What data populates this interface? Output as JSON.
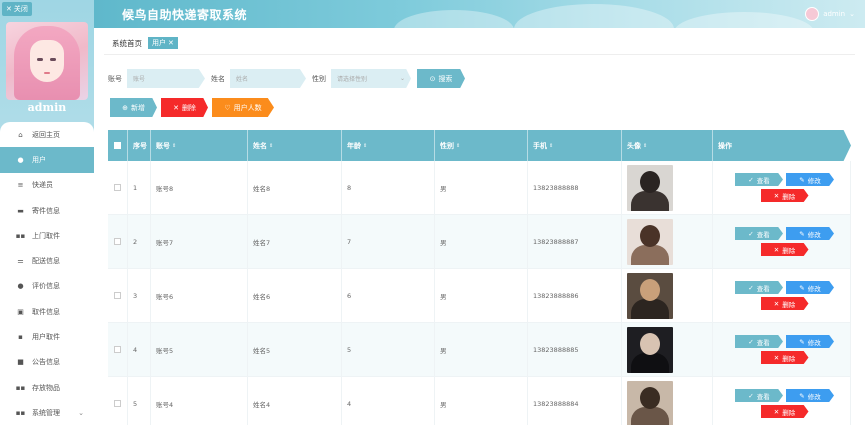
{
  "window": {
    "close_label": "关闭",
    "app_title": "候鸟自助快递寄取系统",
    "username": "admin"
  },
  "sidebar": {
    "profile_name": "admin",
    "items": [
      {
        "label": "返回主页",
        "icon": "home-icon"
      },
      {
        "label": "用户",
        "icon": "user-icon",
        "active": true
      },
      {
        "label": "快递员",
        "icon": "list-icon"
      },
      {
        "label": "寄件信息",
        "icon": "monitor-icon"
      },
      {
        "label": "上门取件",
        "icon": "grid-icon"
      },
      {
        "label": "配送信息",
        "icon": "sliders-icon"
      },
      {
        "label": "评价信息",
        "icon": "location-icon"
      },
      {
        "label": "取件信息",
        "icon": "clipboard-icon"
      },
      {
        "label": "用户取件",
        "icon": "bag-icon"
      },
      {
        "label": "公告信息",
        "icon": "video-icon"
      },
      {
        "label": "存放物品",
        "icon": "grid-icon"
      },
      {
        "label": "系统管理",
        "icon": "grid-icon",
        "has_children": true
      }
    ]
  },
  "breadcrumb": {
    "home": "系统首页",
    "current": "用户"
  },
  "search": {
    "account_label": "账号",
    "account_placeholder": "账号",
    "name_label": "姓名",
    "name_placeholder": "姓名",
    "gender_label": "性别",
    "gender_placeholder": "请选择性别",
    "search_button": "搜索"
  },
  "actions": {
    "add": "新增",
    "delete": "删除",
    "user_count": "用户人数"
  },
  "table": {
    "headers": {
      "index": "序号",
      "account": "账号",
      "name": "姓名",
      "age": "年龄",
      "gender": "性别",
      "phone": "手机",
      "avatar": "头像",
      "ops": "操作"
    },
    "view_label": "查看",
    "edit_label": "修改",
    "delete_label": "删除",
    "rows": [
      {
        "index": "1",
        "account": "账号8",
        "name": "姓名8",
        "age": "8",
        "gender": "男",
        "phone": "13823888888",
        "photo": "dark-haired-young-man"
      },
      {
        "index": "2",
        "account": "账号7",
        "name": "姓名7",
        "age": "7",
        "gender": "男",
        "phone": "13823888887",
        "photo": "woman-with-glasses"
      },
      {
        "index": "3",
        "account": "账号6",
        "name": "姓名6",
        "age": "6",
        "gender": "男",
        "phone": "13823888886",
        "photo": "man-in-dim-room"
      },
      {
        "index": "4",
        "account": "账号5",
        "name": "姓名5",
        "age": "5",
        "gender": "男",
        "phone": "13823888885",
        "photo": "man-in-black"
      },
      {
        "index": "5",
        "account": "账号4",
        "name": "姓名4",
        "age": "4",
        "gender": "男",
        "phone": "13823888884",
        "photo": "person-seated-outdoors"
      }
    ]
  },
  "colors": {
    "primary": "#6cb9ca",
    "danger": "#f52a2a",
    "warning": "#fb8c1c",
    "info": "#3d9df0"
  }
}
